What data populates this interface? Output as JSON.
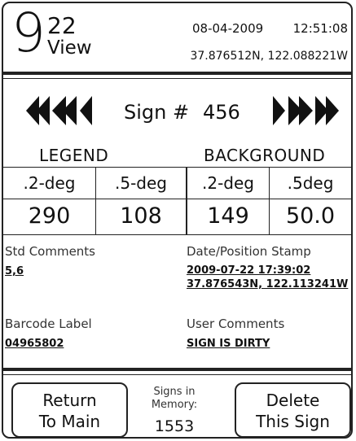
{
  "header": {
    "logo_number": "9",
    "logo_superscript": "22",
    "logo_word": "View",
    "date": "08-04-2009",
    "time": "12:51:08",
    "gps": "37.876512N, 122.088221W"
  },
  "navigation": {
    "prev_icon": "triple-left-arrow-icon",
    "next_icon": "triple-right-arrow-icon",
    "sign_label": "Sign #",
    "sign_number": "456"
  },
  "readings": {
    "legend_title": "LEGEND",
    "background_title": "BACKGROUND",
    "columns": [
      {
        "header": ".2-deg",
        "value": "290"
      },
      {
        "header": ".5-deg",
        "value": "108"
      },
      {
        "header": ".2-deg",
        "value": "149"
      },
      {
        "header": ".5deg",
        "value": "50.0"
      }
    ]
  },
  "details": {
    "std_comments_label": "Std Comments",
    "std_comments_value": "5,6",
    "stamp_label": "Date/Position Stamp",
    "stamp_date": "2009-07-22  17:39:02",
    "stamp_gps": "37.876543N, 122.113241W",
    "barcode_label": "Barcode Label",
    "barcode_value": "04965802",
    "user_comments_label": "User Comments",
    "user_comments_value": "SIGN IS DIRTY"
  },
  "footer": {
    "return_line1": "Return",
    "return_line2": "To Main",
    "memory_line1": "Signs in",
    "memory_line2": "Memory:",
    "memory_count": "1553",
    "delete_line1": "Delete",
    "delete_line2": "This Sign"
  }
}
